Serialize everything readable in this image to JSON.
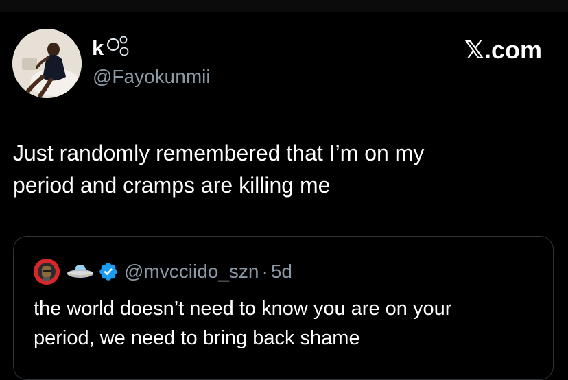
{
  "tweet": {
    "author": {
      "display_name": "k",
      "display_name_emoji_icon": "bubbles-icon",
      "handle": "@Fayokunmii",
      "avatar_icon": "profile-photo"
    },
    "brand": "𝕏.com",
    "text_lines": [
      "Just randomly remembered that I’m on my",
      "period and cramps are killing me"
    ]
  },
  "quote": {
    "avatar_icon": "profile-photo",
    "name_emoji_icon": "ufo-icon",
    "verified_icon": "verified-badge-icon",
    "handle": "@mvcciido_szn",
    "separator": "·",
    "time": "5d",
    "text_lines": [
      "the world doesn’t need to know you are on your",
      "period, we need to bring back shame"
    ]
  },
  "colors": {
    "background": "#000000",
    "text": "#ffffff",
    "secondary_text": "#8b98a5",
    "border": "#2f3336",
    "verified": "#1d9bf0"
  }
}
